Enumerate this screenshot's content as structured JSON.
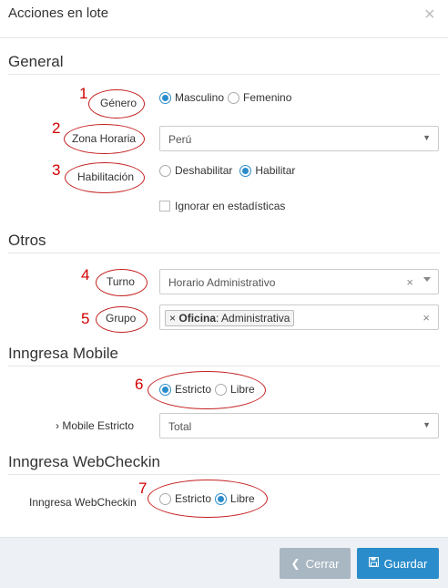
{
  "modal": {
    "title": "Acciones en lote",
    "close_symbol": "×"
  },
  "sections": {
    "general": "General",
    "otros": "Otros",
    "mobile": "Inngresa Mobile",
    "webcheckin": "Inngresa WebCheckin"
  },
  "annotations": [
    "1",
    "2",
    "3",
    "4",
    "5",
    "6",
    "7"
  ],
  "fields": {
    "genero": {
      "label": "Género",
      "options": [
        "Masculino",
        "Femenino"
      ],
      "selected": "Masculino"
    },
    "zona_horaria": {
      "label": "Zona Horaria",
      "value": "Perú"
    },
    "habilitacion": {
      "label": "Habilitación",
      "options": [
        "Deshabilitar",
        "Habilitar"
      ],
      "selected": "Habilitar"
    },
    "ignorar": {
      "label": "Ignorar en estadísticas",
      "checked": false
    },
    "turno": {
      "label": "Turno",
      "value": "Horario Administrativo"
    },
    "grupo": {
      "label": "Grupo",
      "tag_remove": "×",
      "tag_key": "Oficina",
      "tag_value": ": Administrativa"
    },
    "mobile_mode": {
      "options": [
        "Estricto",
        "Libre"
      ],
      "selected": "Estricto"
    },
    "mobile_estricto": {
      "label": "› Mobile Estricto",
      "value": "Total"
    },
    "webcheckin": {
      "label": "Inngresa WebCheckin",
      "options": [
        "Estricto",
        "Libre"
      ],
      "selected": "Libre"
    }
  },
  "footer": {
    "cancel_label": "Cerrar",
    "save_label": "Guardar"
  },
  "icons": {
    "close": "close-icon",
    "cancel": "chevron-left-icon",
    "save": "floppy-disk-icon",
    "select_caret": "caret-down-icon",
    "clear": "clear-icon"
  },
  "colors": {
    "accent": "#2a8ccb",
    "cancel_button": "#a9b7c3",
    "annotation": "#d10000"
  }
}
